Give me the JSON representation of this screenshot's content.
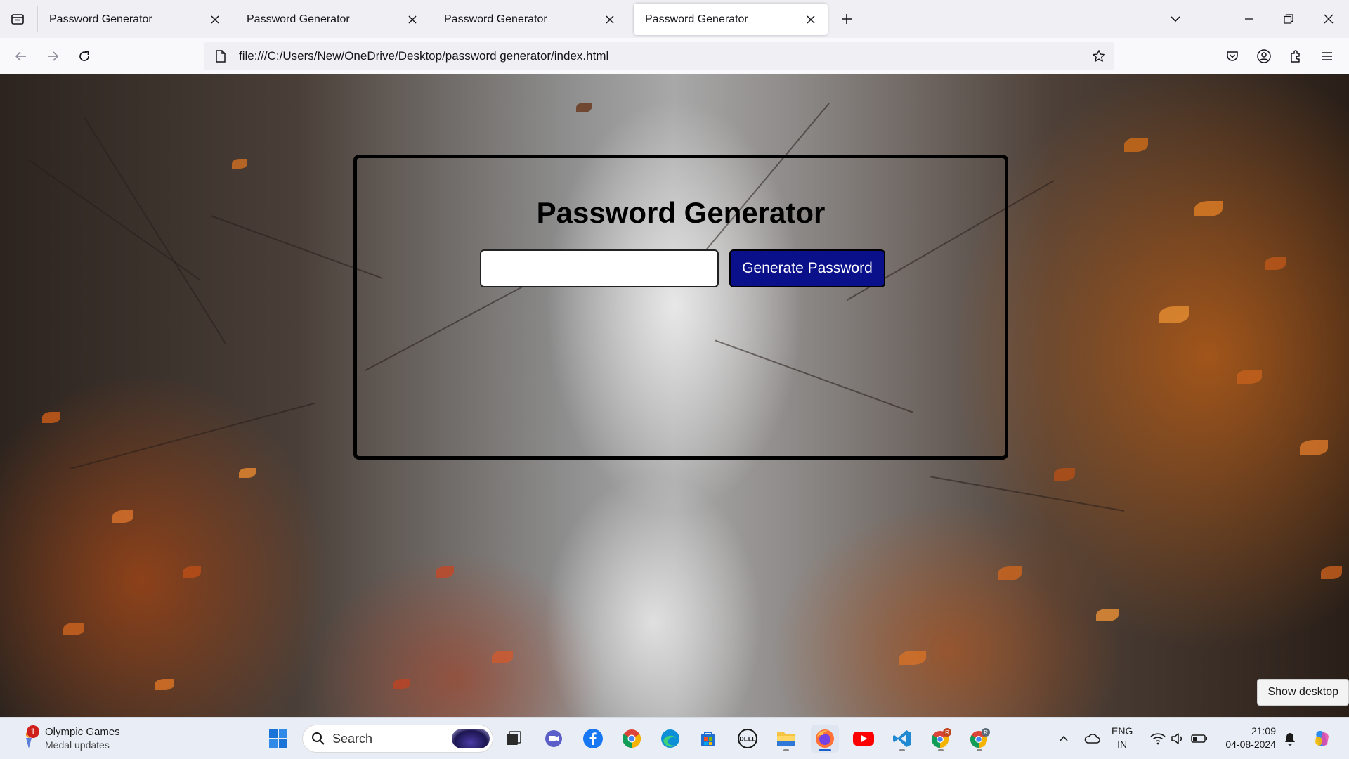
{
  "browser": {
    "tabs": [
      {
        "title": "Password Generator",
        "active": false
      },
      {
        "title": "Password Generator",
        "active": false
      },
      {
        "title": "Password Generator",
        "active": false
      },
      {
        "title": "Password Generator",
        "active": true
      }
    ],
    "url": "file:///C:/Users/New/OneDrive/Desktop/password generator/index.html"
  },
  "page": {
    "title": "Password Generator",
    "password_value": "",
    "generate_label": "Generate Password"
  },
  "tooltip": {
    "show_desktop": "Show desktop"
  },
  "taskbar": {
    "widget": {
      "badge": "1",
      "title": "Olympic Games",
      "subtitle": "Medal updates"
    },
    "search_label": "Search",
    "apps": [
      "task-view",
      "teams-meet",
      "facebook",
      "chrome",
      "edge",
      "microsoft-store",
      "dell",
      "file-explorer",
      "firefox",
      "youtube",
      "vscode",
      "chrome-profile-r",
      "chrome-profile-r2"
    ],
    "tray": {
      "lang_top": "ENG",
      "lang_bottom": "IN",
      "time": "21:09",
      "date": "04-08-2024"
    }
  },
  "colors": {
    "button_bg": "#0a0f8a",
    "taskbar_bg": "#e9eef6",
    "tabstrip_bg": "#f0f0f4"
  }
}
